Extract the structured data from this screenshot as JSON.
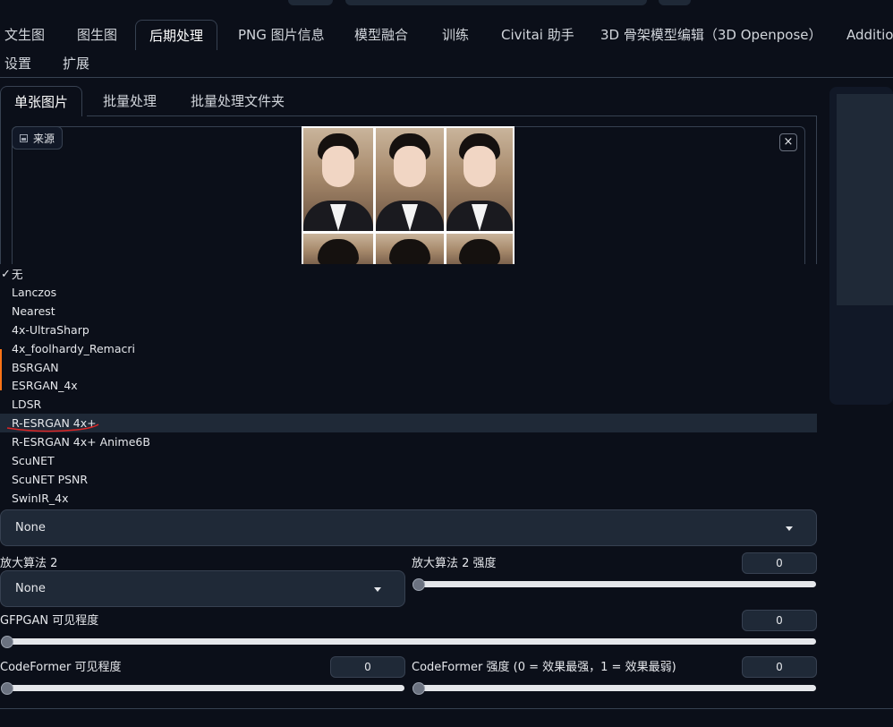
{
  "nav": {
    "tabs": [
      "文生图",
      "图生图",
      "后期处理",
      "PNG 图片信息",
      "模型融合",
      "训练",
      "Civitai 助手",
      "3D 骨架模型编辑（3D Openpose）",
      "Addition",
      "设置",
      "扩展"
    ],
    "active": "后期处理"
  },
  "subtabs": {
    "items": [
      "单张图片",
      "批量处理",
      "批量处理文件夹"
    ],
    "active": "单张图片"
  },
  "source": {
    "label": "来源",
    "close": "×"
  },
  "upscaler1": {
    "options": [
      "无",
      "Lanczos",
      "Nearest",
      "4x-UltraSharp",
      "4x_foolhardy_Remacri",
      "BSRGAN",
      "ESRGAN_4x",
      "LDSR",
      "R-ESRGAN 4x+",
      "R-ESRGAN 4x+ Anime6B",
      "ScuNET",
      "ScuNET PSNR",
      "SwinIR_4x"
    ],
    "selected": "无",
    "hovered": "R-ESRGAN 4x+",
    "value": "None"
  },
  "upscaler2": {
    "label": "放大算法 2",
    "value": "None"
  },
  "upscaler2_strength": {
    "label": "放大算法 2 强度",
    "value": "0",
    "level": 0
  },
  "gfpgan": {
    "label": "GFPGAN 可见程度",
    "value": "0",
    "level": 0
  },
  "codeformer_visibility": {
    "label": "CodeFormer 可见程度",
    "value": "0",
    "level": 0
  },
  "codeformer_weight": {
    "label": "CodeFormer 强度 (0 = 效果最强，1 = 效果最弱)",
    "value": "0",
    "level": 0
  },
  "colors": {
    "background": "#0b0f19",
    "panel": "#1f2937",
    "border": "#374151",
    "accent": "#f97316",
    "annotation": "#dc2626"
  }
}
